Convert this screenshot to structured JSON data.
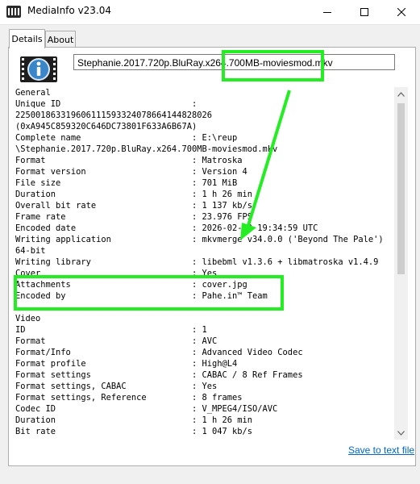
{
  "window": {
    "title": "MediaInfo v23.04"
  },
  "tabs": [
    {
      "label": "Details",
      "active": true
    },
    {
      "label": "About",
      "active": false
    }
  ],
  "file": {
    "name": "Stephanie.2017.720p.BluRay.x264.700MB-moviesmod.mkv"
  },
  "info_lines": [
    "General",
    "Unique ID                          :",
    "225001863319606111593324078664144828026",
    "(0xA945C859320C646DC73801F633A6B67A)",
    "Complete name                      : E:\\reup",
    "\\Stephanie.2017.720p.BluRay.x264.700MB-moviesmod.mkv",
    "Format                             : Matroska",
    "Format version                     : Version 4",
    "File size                          : 701 MiB",
    "Duration                           : 1 h 26 min",
    "Overall bit rate                   : 1 137 kb/s",
    "Frame rate                         : 23.976 FPS",
    "Encoded date                       : 2026-02-10 19:34:59 UTC",
    "Writing application                : mkvmerge v34.0.0 ('Beyond The Pale')",
    "64-bit",
    "Writing library                    : libebml v1.3.6 + libmatroska v1.4.9",
    "Cover                              : Yes",
    "Attachments                        : cover.jpg",
    "Encoded by                         : Pahe.in™ Team",
    "",
    "Video",
    "ID                                 : 1",
    "Format                             : AVC",
    "Format/Info                        : Advanced Video Codec",
    "Format profile                     : High@L4",
    "Format settings                    : CABAC / 8 Ref Frames",
    "Format settings, CABAC             : Yes",
    "Format settings, Reference         : 8 frames",
    "Codec ID                           : V_MPEG4/ISO/AVC",
    "Duration                           : 1 h 26 min",
    "Bit rate                           : 1 047 kb/s"
  ],
  "footer": {
    "save_link": "Save to text file"
  },
  "annotation": {
    "color": "#22ee22"
  }
}
